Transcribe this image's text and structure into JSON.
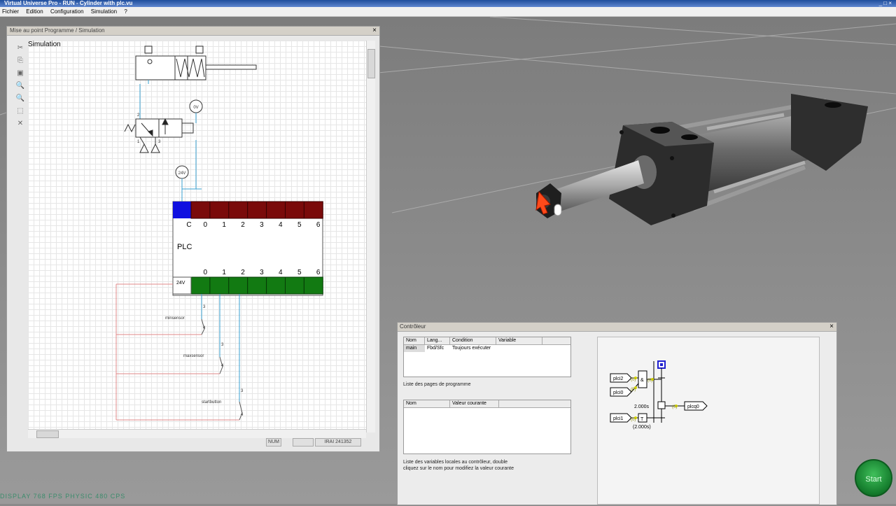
{
  "app": {
    "title": "Virtual Universe Pro - RUN - Cylinder with plc.vu",
    "window_buttons": "_ □ ×"
  },
  "menu": {
    "items": [
      "Fichier",
      "Edition",
      "Configuration",
      "Simulation",
      "?"
    ]
  },
  "program_window": {
    "caption": "Mise au point Programme / Simulation",
    "close": "×",
    "canvas_title": "Simulation",
    "tools": [
      "✂",
      "⎘",
      "▣",
      "🔍",
      "🔍",
      "⬚",
      "✕"
    ],
    "plc": {
      "label": "PLC",
      "inputs_common": "C",
      "input_labels": [
        "0",
        "1",
        "2",
        "3",
        "4",
        "5",
        "6"
      ],
      "output_labels": [
        "0",
        "1",
        "2",
        "3",
        "4",
        "5",
        "6"
      ],
      "supply_label": "24V"
    },
    "sources": {
      "ov": "0V",
      "v24": "24V"
    },
    "sensors": [
      "minsensor",
      "maxsensor",
      "startbutton"
    ],
    "port_numbers": {
      "p2": "2",
      "p1": "1",
      "p3": "3",
      "p4": "4"
    },
    "status": {
      "num": "NUM",
      "irai": "IRAI  241352"
    }
  },
  "controller_window": {
    "caption": "Contrôleur",
    "close": "×",
    "pages_table": {
      "headers": [
        "Nom",
        "Lang...",
        "Condition",
        "Variable"
      ],
      "rows": [
        [
          "main",
          "Fbd/Sfc",
          "Toujours exécuter",
          ""
        ]
      ]
    },
    "pages_note": "Liste des pages de programme",
    "vars_table": {
      "headers": [
        "Nom",
        "Valeur courante"
      ],
      "rows": []
    },
    "vars_note_1": "Liste des variables locales au contrôleur, double",
    "vars_note_2": "cliquez sur le nom pour modifiez la valeur courante",
    "fbd": {
      "in1": "plci2",
      "in2": "plci0",
      "in3": "plci1",
      "out": "plcq0",
      "and_label": "&",
      "timer_label": "T",
      "timer_preset": "2.000s",
      "timer_value": "(2.000s)",
      "zero": "(0)"
    }
  },
  "start_button": {
    "label": "Start"
  },
  "watermark": "DISPLAY 768 FPS  PHYSIC 480 CPS",
  "colors": {
    "plc_input_active": "#1010e0",
    "plc_input": "#7a0a0a",
    "plc_output": "#127a12",
    "start": "#1f9a3c"
  }
}
